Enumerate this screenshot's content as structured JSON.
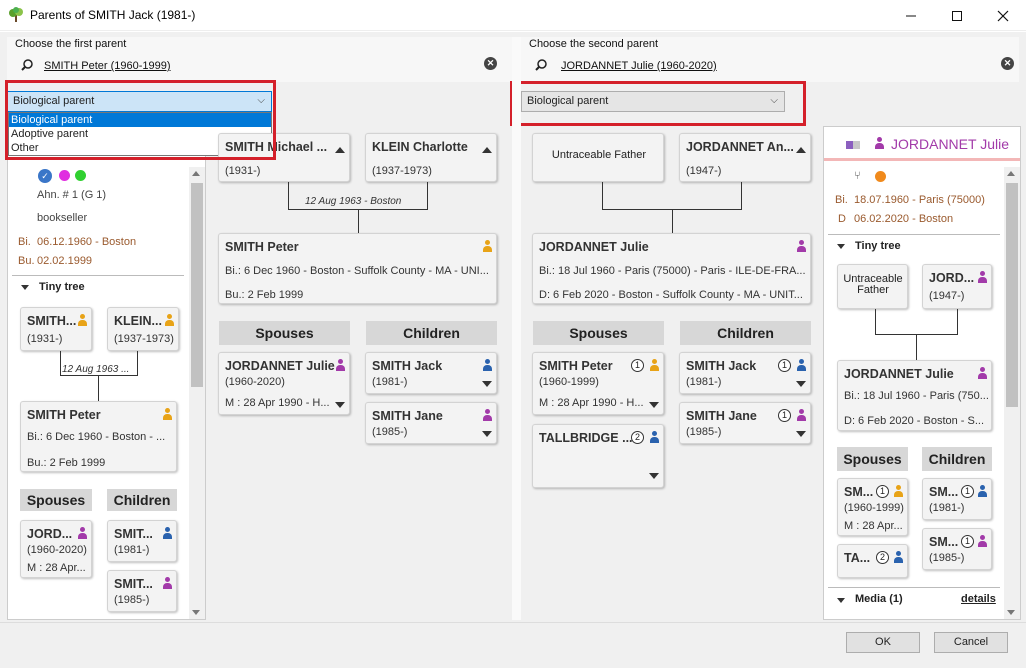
{
  "window": {
    "title": "Parents of SMITH Jack (1981-)"
  },
  "first": {
    "label": "Choose the first parent",
    "search_value": "SMITH Peter (1960-1999)",
    "relation_value": "Biological parent",
    "options": [
      "Biological parent",
      "Adoptive parent",
      "Other"
    ]
  },
  "second": {
    "label": "Choose the second parent",
    "search_value": "JORDANNET Julie (1960-2020)",
    "relation_value": "Biological parent"
  },
  "left": {
    "ahn": "Ahn. # 1 (G 1)",
    "occupation": "bookseller",
    "bi_label": "Bi.",
    "bi_value": "06.12.1960 - Boston",
    "bu_label": "Bu.",
    "bu_value": "02.02.1999",
    "tiny_tree": "Tiny tree",
    "p1_name": "SMITH...",
    "p1_dates": "(1931-)",
    "p2_name": "KLEIN...",
    "p2_dates": "(1937-1973)",
    "marriage": "12 Aug 1963 ...",
    "main_name": "SMITH Peter",
    "main_bi": "Bi.: 6 Dec 1960 - Boston - ...",
    "main_bu": "Bu.: 2 Feb 1999",
    "spouses": "Spouses",
    "children": "Children",
    "sp_name": "JORD...",
    "sp_dates": "(1960-2020)",
    "sp_m": "M : 28 Apr...",
    "c1_name": "SMIT...",
    "c1_dates": "(1981-)",
    "c2_name": "SMIT...",
    "c2_dates": "(1985-)"
  },
  "center1": {
    "f_name": "SMITH Michael ...",
    "f_dates": "(1931-)",
    "m_name": "KLEIN Charlotte",
    "m_dates": "(1937-1973)",
    "marriage": "12 Aug 1963 - Boston",
    "main_name": "SMITH Peter",
    "main_bi": "Bi.: 6 Dec 1960 - Boston - Suffolk County - MA - UNI...",
    "main_bu": "Bu.: 2 Feb 1999",
    "spouses": "Spouses",
    "children": "Children",
    "sp_name": "JORDANNET Julie",
    "sp_dates": "(1960-2020)",
    "sp_m": "M : 28 Apr 1990 - H...",
    "c1_name": "SMITH Jack",
    "c1_dates": "(1981-)",
    "c2_name": "SMITH Jane",
    "c2_dates": "(1985-)"
  },
  "center2": {
    "f_name": "Untraceable Father",
    "m_name": "JORDANNET An...",
    "m_dates": "(1947-)",
    "main_name": "JORDANNET Julie",
    "main_bi": "Bi.: 18 Jul 1960 - Paris (75000) - Paris - ILE-DE-FRA...",
    "main_d": "D: 6 Feb 2020 - Boston - Suffolk County - MA - UNIT...",
    "spouses": "Spouses",
    "children": "Children",
    "sp1_name": "SMITH Peter",
    "sp1_badge": "1",
    "sp1_dates": "(1960-1999)",
    "sp1_m": "M : 28 Apr 1990 - H...",
    "sp2_name": "TALLBRIDGE ...",
    "sp2_badge": "2",
    "c1_name": "SMITH Jack",
    "c1_badge": "1",
    "c1_dates": "(1981-)",
    "c2_name": "SMITH Jane",
    "c2_badge": "1",
    "c2_dates": "(1985-)"
  },
  "right": {
    "name": "JORDANNET Julie",
    "bi_label": "Bi.",
    "bi_value": "18.07.1960 - Paris (75000)",
    "d_label": "D",
    "d_value": "06.02.2020 - Boston",
    "tiny_tree": "Tiny tree",
    "f_name": "Untraceable Father",
    "m_name": "JORD...",
    "m_dates": "(1947-)",
    "main_name": "JORDANNET Julie",
    "main_bi": "Bi.: 18 Jul 1960 - Paris (750...",
    "main_d": "D: 6 Feb 2020 - Boston - S...",
    "spouses": "Spouses",
    "children": "Children",
    "sp1_name": "SM...",
    "sp1_badge": "1",
    "sp1_dates": "(1960-1999)",
    "sp1_m": "M : 28 Apr...",
    "sp2_name": "TA...",
    "sp2_badge": "2",
    "c1_name": "SM...",
    "c1_badge": "1",
    "c1_dates": "(1981-)",
    "c2_name": "SM...",
    "c2_badge": "1",
    "c2_dates": "(1985-)",
    "media": "Media (1)",
    "details": "details"
  },
  "buttons": {
    "ok": "OK",
    "cancel": "Cancel"
  },
  "colors": {
    "accent_red": "#d4202a",
    "selection_blue": "#0078d7",
    "male": "#2a62ae",
    "female": "#a23aa9",
    "unknown": "#e8a317"
  }
}
